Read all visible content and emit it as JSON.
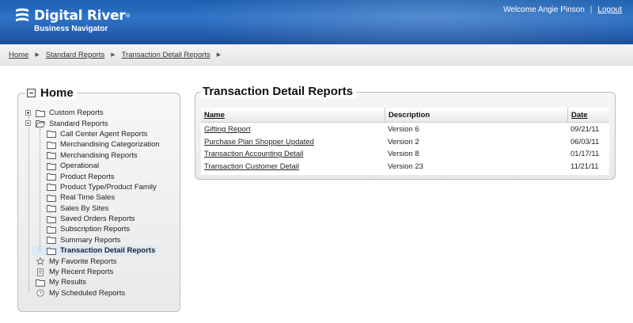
{
  "header": {
    "brand": "Digital River",
    "brand_sup": "®",
    "subtitle": "Business Navigator",
    "welcome": "Welcome Angie Pinson",
    "separator": "|",
    "logout": "Logout"
  },
  "breadcrumb": {
    "items": [
      "Home",
      "Standard Reports",
      "Transaction Detail Reports"
    ],
    "arrow": "▶"
  },
  "tree": {
    "title": "Home",
    "nodes": [
      {
        "label": "Custom Reports",
        "icon": "folder-icon",
        "expander": "plus"
      },
      {
        "label": "Standard Reports",
        "icon": "folder-open-icon",
        "expander": "minus"
      },
      {
        "label": "Call Center Agent Reports",
        "icon": "folder-icon"
      },
      {
        "label": "Merchandising Categorization",
        "icon": "folder-icon"
      },
      {
        "label": "Merchandising Reports",
        "icon": "folder-icon"
      },
      {
        "label": "Operational",
        "icon": "folder-icon"
      },
      {
        "label": "Product Reports",
        "icon": "folder-icon"
      },
      {
        "label": "Product Type/Product Family",
        "icon": "folder-icon"
      },
      {
        "label": "Real Time Sales",
        "icon": "folder-icon"
      },
      {
        "label": "Sales By Sites",
        "icon": "folder-icon"
      },
      {
        "label": "Saved Orders Reports",
        "icon": "folder-icon"
      },
      {
        "label": "Subscription Reports",
        "icon": "folder-icon"
      },
      {
        "label": "Summary Reports",
        "icon": "folder-icon"
      },
      {
        "label": "Transaction Detail Reports",
        "icon": "folder-icon",
        "selected": true
      },
      {
        "label": "My Favorite Reports",
        "icon": "star-icon"
      },
      {
        "label": "My Recent Reports",
        "icon": "document-icon"
      },
      {
        "label": "My Results",
        "icon": "folder-icon"
      },
      {
        "label": "My Scheduled Reports",
        "icon": "clock-icon"
      }
    ]
  },
  "main": {
    "title": "Transaction Detail Reports",
    "columns": [
      "Name",
      "Description",
      "Date"
    ],
    "rows": [
      {
        "name": "Gifting Report",
        "description": "Version 6",
        "date": "09/21/11"
      },
      {
        "name": "Purchase Plan Shopper Updated",
        "description": "Version 2",
        "date": "06/03/11"
      },
      {
        "name": "Transaction Accounting Detail",
        "description": "Version 8",
        "date": "01/17/11"
      },
      {
        "name": "Transaction Customer Detail",
        "description": "Version 23",
        "date": "11/21/11"
      }
    ]
  },
  "colors": {
    "header_blue": "#1d5fb0",
    "selection": "#dde9f7",
    "panel_border": "#bdbdbd"
  }
}
